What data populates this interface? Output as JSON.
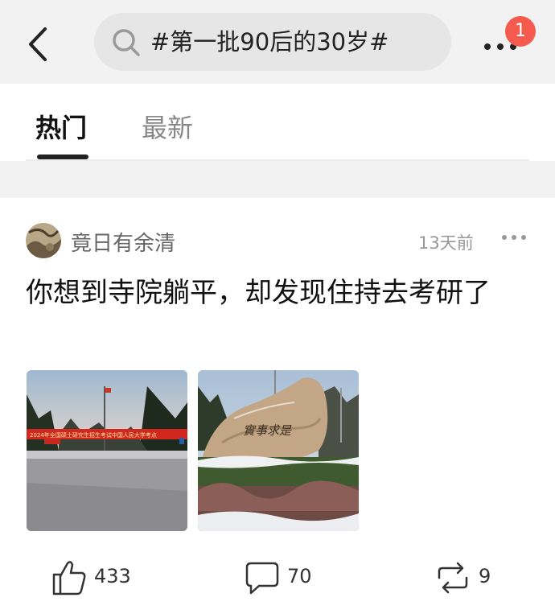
{
  "header": {
    "search_text": "#第一批90后的30岁#",
    "notification_count": "1",
    "icons": {
      "back": "chevron-left-icon",
      "search": "search-icon",
      "more": "more-icon"
    }
  },
  "tabs": [
    {
      "label": "热门",
      "active": true
    },
    {
      "label": "最新",
      "active": false
    }
  ],
  "post": {
    "author": "竟日有余清",
    "time": "13天前",
    "text": "你想到寺院躺平，却发现住持去考研了",
    "photos": [
      {
        "banner_text": "2024年全国硕士研究生招生考试中国人民大学考点"
      },
      {
        "rock_text": "實事求是"
      }
    ],
    "actions": {
      "like_count": "433",
      "comment_count": "70",
      "repost_count": "9"
    }
  }
}
